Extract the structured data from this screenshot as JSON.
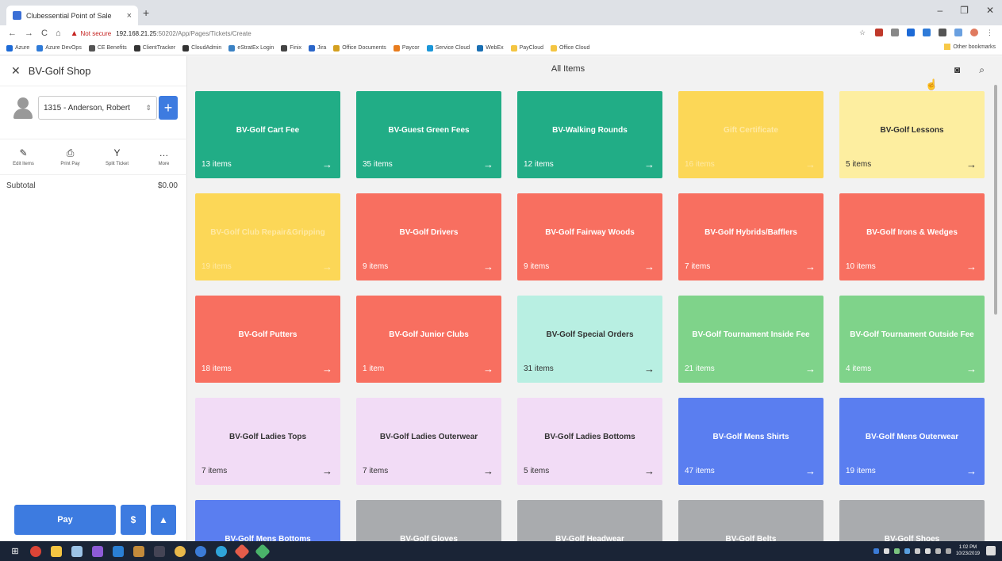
{
  "browser": {
    "tab_title": "Clubessential Point of Sale",
    "tab_close": "×",
    "new_tab": "+",
    "window_controls": [
      "–",
      "❐",
      "✕"
    ],
    "not_secure": "Not secure",
    "url_host": "192.168.21.25",
    "url_path": ":50202/App/Pages/Tickets/Create",
    "bookmarks": [
      {
        "label": "Azure",
        "color": "#1d6ad6"
      },
      {
        "label": "Azure DevOps",
        "color": "#2f7bd8"
      },
      {
        "label": "CE Benefits",
        "color": "#555555"
      },
      {
        "label": "ClientTracker",
        "color": "#333333"
      },
      {
        "label": "CloudAdmin",
        "color": "#333333"
      },
      {
        "label": "eStratEx Login",
        "color": "#3b82c4"
      },
      {
        "label": "Finix",
        "color": "#444444"
      },
      {
        "label": "Jira",
        "color": "#2a66c9"
      },
      {
        "label": "Office Documents",
        "color": "#d4a020"
      },
      {
        "label": "Paycor",
        "color": "#e87d1e"
      },
      {
        "label": "Service Cloud",
        "color": "#1b96d8"
      },
      {
        "label": "WebEx",
        "color": "#1a6fb3"
      },
      {
        "label": "PayCloud",
        "color": "#f4c542"
      },
      {
        "label": "Office Cloud",
        "color": "#f4c542"
      }
    ],
    "other_bookmarks": "Other bookmarks"
  },
  "left_panel": {
    "header": "BV-Golf Shop",
    "member": "1315 - Anderson, Robert",
    "add_member": "+",
    "actions": [
      {
        "label": "Edit Items",
        "icon": "pencil-icon",
        "glyph": "✎"
      },
      {
        "label": "Print Pay",
        "icon": "printer-icon",
        "glyph": "⎙"
      },
      {
        "label": "Split Ticket",
        "icon": "split-icon",
        "glyph": "Y"
      },
      {
        "label": "More",
        "icon": "more-icon",
        "glyph": "…"
      }
    ],
    "subtotal_label": "Subtotal",
    "subtotal_value": "$0.00",
    "pay_label": "Pay",
    "dollar_label": "$",
    "person_label": "▲"
  },
  "main": {
    "title": "All Items",
    "tiles": [
      {
        "name": "BV-Golf Cart Fee",
        "count": "13 items",
        "color": "#21ad86",
        "style": "light"
      },
      {
        "name": "BV-Guest Green Fees",
        "count": "35 items",
        "color": "#21ad86",
        "style": "light"
      },
      {
        "name": "BV-Walking Rounds",
        "count": "12 items",
        "color": "#21ad86",
        "style": "light"
      },
      {
        "name": "Gift Certificate",
        "count": "16 items",
        "color": "#fcd757",
        "style": "faded"
      },
      {
        "name": "BV-Golf Lessons",
        "count": "5 items",
        "color": "#fdeea0",
        "style": "dark"
      },
      {
        "name": "BV-Golf Club Repair&Gripping",
        "count": "19 items",
        "color": "#fcd757",
        "style": "faded"
      },
      {
        "name": "BV-Golf Drivers",
        "count": "9 items",
        "color": "#f86f60",
        "style": "light"
      },
      {
        "name": "BV-Golf Fairway Woods",
        "count": "9 items",
        "color": "#f86f60",
        "style": "light"
      },
      {
        "name": "BV-Golf Hybrids/Bafflers",
        "count": "7 items",
        "color": "#f86f60",
        "style": "light"
      },
      {
        "name": "BV-Golf Irons & Wedges",
        "count": "10 items",
        "color": "#f86f60",
        "style": "light"
      },
      {
        "name": "BV-Golf Putters",
        "count": "18 items",
        "color": "#f86f60",
        "style": "light"
      },
      {
        "name": "BV-Golf Junior Clubs",
        "count": "1 item",
        "color": "#f86f60",
        "style": "light"
      },
      {
        "name": "BV-Golf Special Orders",
        "count": "31 items",
        "color": "#b8efe2",
        "style": "dark"
      },
      {
        "name": "BV-Golf Tournament Inside Fee",
        "count": "21 items",
        "color": "#7fd38a",
        "style": "light"
      },
      {
        "name": "BV-Golf Tournament Outside Fee",
        "count": "4 items",
        "color": "#7fd38a",
        "style": "light"
      },
      {
        "name": "BV-Golf Ladies Tops",
        "count": "7 items",
        "color": "#f2dcf6",
        "style": "dark"
      },
      {
        "name": "BV-Golf Ladies Outerwear",
        "count": "7 items",
        "color": "#f2dcf6",
        "style": "dark"
      },
      {
        "name": "BV-Golf Ladies Bottoms",
        "count": "5 items",
        "color": "#f2dcf6",
        "style": "dark"
      },
      {
        "name": "BV-Golf Mens Shirts",
        "count": "47 items",
        "color": "#5a7ef0",
        "style": "light"
      },
      {
        "name": "BV-Golf Mens Outerwear",
        "count": "19 items",
        "color": "#5a7ef0",
        "style": "light"
      },
      {
        "name": "BV-Golf Mens Bottoms",
        "count": "",
        "color": "#5a7ef0",
        "style": "light"
      },
      {
        "name": "BV-Golf Gloves",
        "count": "",
        "color": "#a9abae",
        "style": "light"
      },
      {
        "name": "BV-Golf Headwear",
        "count": "",
        "color": "#a9abae",
        "style": "light"
      },
      {
        "name": "BV-Golf Belts",
        "count": "",
        "color": "#a9abae",
        "style": "light"
      },
      {
        "name": "BV-Golf Shoes",
        "count": "",
        "color": "#a9abae",
        "style": "light"
      }
    ]
  },
  "taskbar": {
    "time": "1:02 PM",
    "date": "10/23/2019"
  }
}
